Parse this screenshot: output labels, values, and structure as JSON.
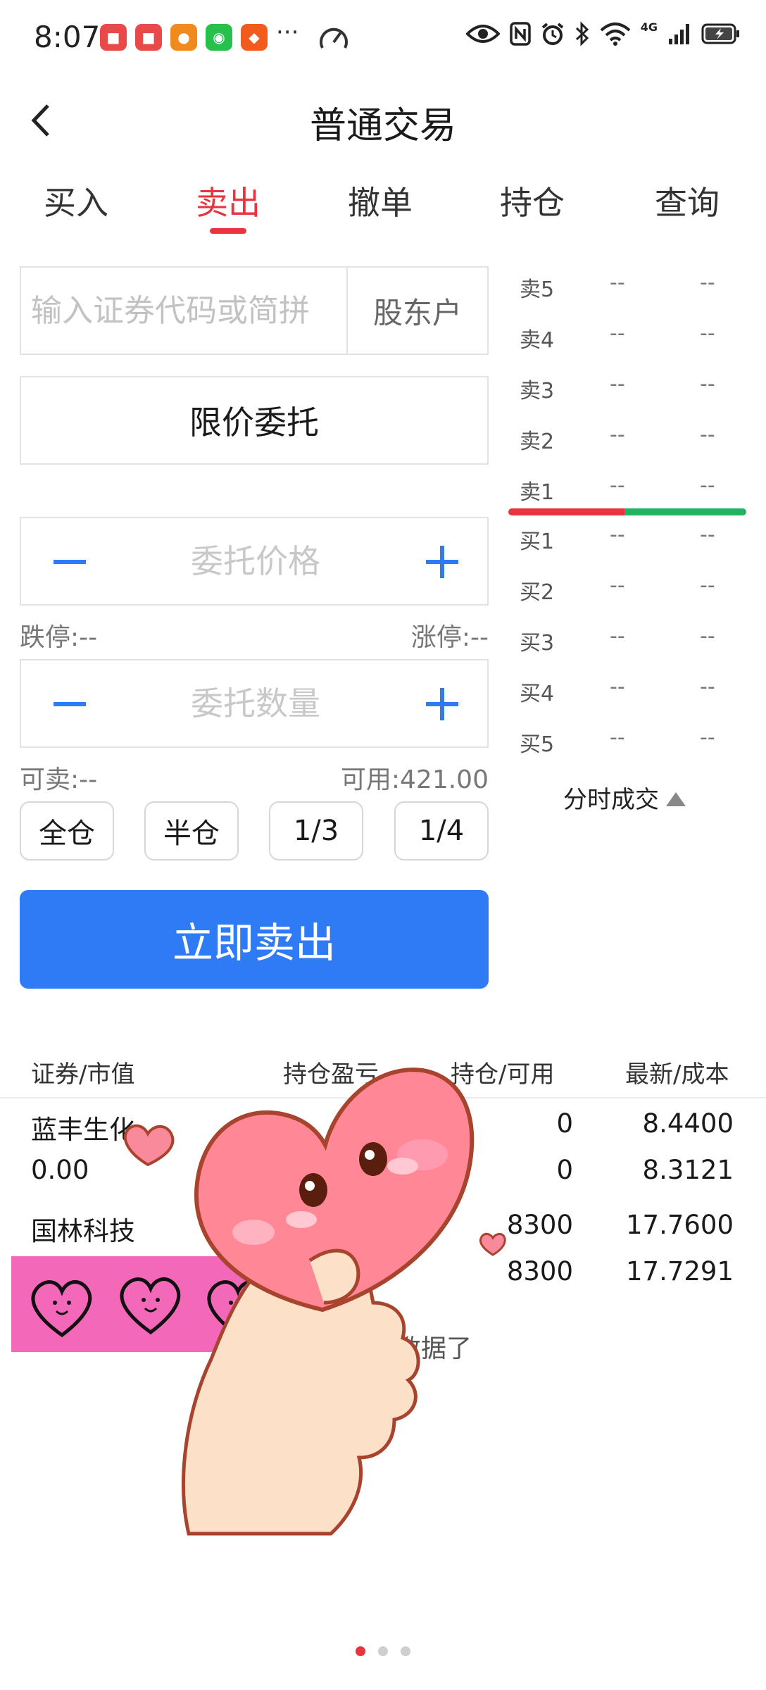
{
  "status_bar": {
    "time": "8:07",
    "app_icons": [
      "red-book-icon",
      "red-book-icon",
      "orange-app-icon",
      "wechat-icon",
      "taobao-icon"
    ],
    "more": "···",
    "network": "4G",
    "right_icons": [
      "eye-icon",
      "nfc-icon",
      "alarm-icon",
      "bluetooth-icon",
      "wifi-icon",
      "signal-icon",
      "battery-charging-icon"
    ]
  },
  "header": {
    "title": "普通交易",
    "back_icon": "chevron-left-icon"
  },
  "tabs": [
    {
      "label": "买入",
      "active": false
    },
    {
      "label": "卖出",
      "active": true
    },
    {
      "label": "撤单",
      "active": false
    },
    {
      "label": "持仓",
      "active": false
    },
    {
      "label": "查询",
      "active": false
    }
  ],
  "form": {
    "code_placeholder": "输入证券代码或简拼",
    "code_value": "",
    "holder_label": "股东户",
    "order_type": "限价委托",
    "price_placeholder": "委托价格",
    "price_value": "",
    "limit_down_label": "跌停:--",
    "limit_up_label": "涨停:--",
    "qty_placeholder": "委托数量",
    "qty_value": "",
    "sellable_label": "可卖:--",
    "available_label": "可用:421.00",
    "quick_buttons": [
      "全仓",
      "半仓",
      "1/3",
      "1/4"
    ],
    "submit_label": "立即卖出",
    "accent_color": "#2f7bf5"
  },
  "order_book": {
    "sell": [
      {
        "label": "卖5",
        "price": "--",
        "volume": "--"
      },
      {
        "label": "卖4",
        "price": "--",
        "volume": "--"
      },
      {
        "label": "卖3",
        "price": "--",
        "volume": "--"
      },
      {
        "label": "卖2",
        "price": "--",
        "volume": "--"
      },
      {
        "label": "卖1",
        "price": "--",
        "volume": "--"
      }
    ],
    "buy": [
      {
        "label": "买1",
        "price": "--",
        "volume": "--"
      },
      {
        "label": "买2",
        "price": "--",
        "volume": "--"
      },
      {
        "label": "买3",
        "price": "--",
        "volume": "--"
      },
      {
        "label": "买4",
        "price": "--",
        "volume": "--"
      },
      {
        "label": "买5",
        "price": "--",
        "volume": "--"
      }
    ],
    "toggle_label": "分时成交",
    "sell_color": "#e8343f",
    "buy_color": "#22b262"
  },
  "positions": {
    "headers": [
      "证券/市值",
      "持仓盈亏",
      "持仓/可用",
      "最新/成本"
    ],
    "rows": [
      {
        "name": "蓝丰生化",
        "market_value": "0.00",
        "holding": "0",
        "available": "0",
        "latest": "8.4400",
        "cost": "8.3121"
      },
      {
        "name": "国林科技",
        "market_value": "",
        "holding": "8300",
        "available": "8300",
        "latest": "17.7600",
        "cost": "17.7291"
      }
    ],
    "empty_note": "没有更多数据了"
  },
  "pager": {
    "count": 3,
    "active": 0
  }
}
